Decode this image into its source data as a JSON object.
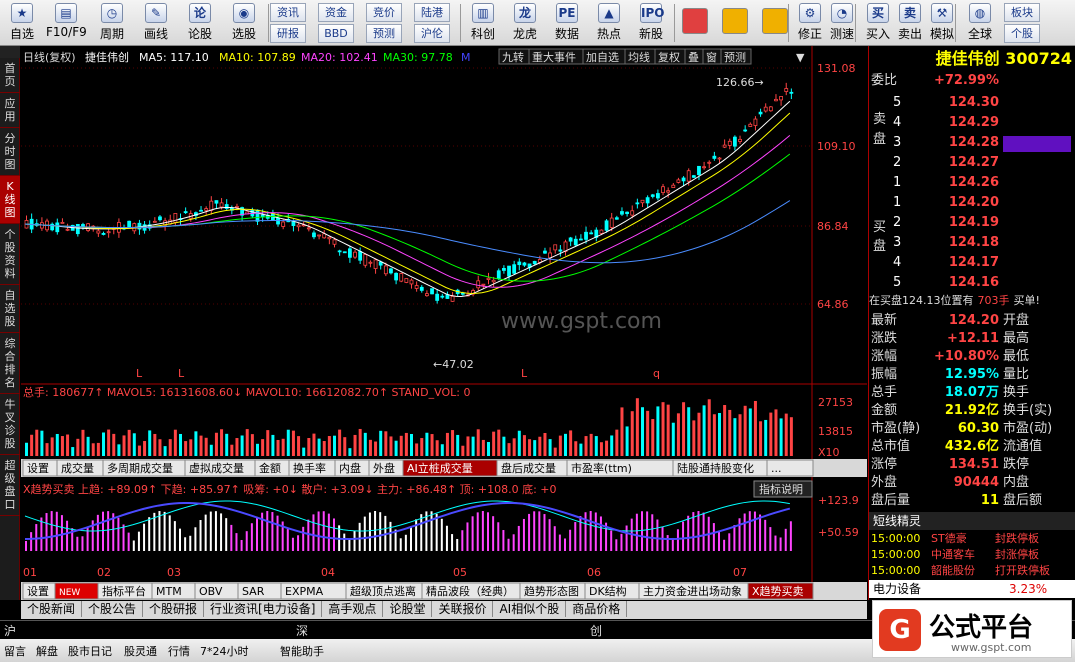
{
  "toolbar": {
    "items": [
      "自选",
      "F10/F9",
      "周期",
      "画线",
      "论股",
      "选股",
      "资讯",
      "研报",
      "资金",
      "BBD",
      "竞价",
      "预测",
      "陆港",
      "沪伦",
      "科创",
      "龙虎",
      "数据",
      "热点",
      "新股",
      "修正",
      "测速",
      "买入",
      "卖出",
      "模拟",
      "全球",
      "板块",
      "个股"
    ]
  },
  "leftnav": [
    "首页",
    "应用",
    "分时图",
    "K线图",
    "个股资料",
    "自选股",
    "综合排名",
    "牛叉诊股",
    "超级盘口"
  ],
  "chart": {
    "header": {
      "mode": "日线(复权)",
      "name": "捷佳伟创",
      "ma5": "MA5: 117.10",
      "ma10": "MA10: 107.89",
      "ma20": "MA20: 102.41",
      "ma30": "MA30: 97.78",
      "m": "M"
    },
    "toptabs": [
      "九转",
      "重大事件",
      "加自选",
      "均线",
      "复权",
      "叠",
      "窗",
      "预测"
    ],
    "yticks": [
      "131.08",
      "109.10",
      "86.84",
      "64.86"
    ],
    "high_label": "126.66",
    "low_label": "47.02",
    "vol_header": "总手: 180677↑ MAVOL5: 16131608.60↓ MAVOL10: 16612082.70↑ STAND_VOL: 0",
    "vol_ticks": [
      "27153",
      "13815",
      "X10"
    ],
    "mid_tabs": [
      "设置",
      "成交量",
      "多周期成交量",
      "虚拟成交量",
      "金额",
      "换手率",
      "内盘",
      "外盘",
      "AI立桩成交量",
      "盘后成交量",
      "市盈率(ttm)",
      "陆股通持股变化",
      "..."
    ],
    "ind_header": "X趋势买卖 上趋: +89.09↑ 下趋: +85.97↑ 吸筹: +0↓ 散户: +3.09↓ 主力: +86.48↑ 顶: +108.0 底: +0",
    "ind_btn": "指标说明",
    "ind_ticks": [
      "+123.9",
      "+50.59"
    ],
    "months": [
      "01",
      "02",
      "03",
      "04",
      "05",
      "06",
      "07"
    ],
    "ind_tabs": [
      "设置",
      "NEW",
      "指标平台",
      "MTM",
      "OBV",
      "SAR",
      "EXPMA",
      "超级顶点逃离",
      "精品波段（经典）",
      "趋势形态图",
      "DK结构",
      "主力资金进出场动象",
      "X趋势买卖"
    ],
    "info_tabs": [
      "个股新闻",
      "个股公告",
      "个股研报",
      "行业资讯[电力设备]",
      "高手观点",
      "论股堂",
      "关联报价",
      "AI相似个股",
      "商品价格"
    ],
    "watermark": "www.gspt.com"
  },
  "quote": {
    "title": "捷佳伟创 300724",
    "weibi_label": "委比",
    "weibi": "+72.99%",
    "sell_label": "卖盘",
    "buy_label": "买盘",
    "sells": [
      [
        "5",
        "124.30"
      ],
      [
        "4",
        "124.29"
      ],
      [
        "3",
        "124.28"
      ],
      [
        "2",
        "124.27"
      ],
      [
        "1",
        "124.26"
      ]
    ],
    "buys": [
      [
        "1",
        "124.20"
      ],
      [
        "2",
        "124.19"
      ],
      [
        "3",
        "124.18"
      ],
      [
        "4",
        "124.17"
      ],
      [
        "5",
        "124.16"
      ]
    ],
    "note": "在买盘124.13位置有",
    "note2": "703手",
    "note3": "买单!",
    "stats": [
      [
        "最新",
        "124.20",
        "开盘"
      ],
      [
        "涨跌",
        "+12.11",
        "最高"
      ],
      [
        "涨幅",
        "+10.80%",
        "最低"
      ],
      [
        "振幅",
        "12.95%",
        "量比"
      ],
      [
        "总手",
        "18.07万",
        "换手"
      ],
      [
        "金额",
        "21.92亿",
        "换手(实)"
      ],
      [
        "市盈(静)",
        "60.30",
        "市盈(动)"
      ],
      [
        "总市值",
        "432.6亿",
        "流通值"
      ],
      [
        "涨停",
        "134.51",
        "跌停"
      ],
      [
        "外盘",
        "90444",
        "内盘"
      ],
      [
        "盘后量",
        "11",
        "盘后额"
      ]
    ],
    "elves_title": "短线精灵",
    "elves": [
      [
        "15:00:00",
        "ST德豪",
        "封跌停板"
      ],
      [
        "15:00:00",
        "中通客车",
        "封涨停板"
      ],
      [
        "15:00:00",
        "韶能股份",
        "打开跌停板"
      ]
    ],
    "sector": "电力设备",
    "sector_val": "3.23%"
  },
  "status": {
    "items": [
      "沪",
      "深",
      "创"
    ],
    "bottom": [
      "留言",
      "解盘",
      "股市日记",
      "股灵通",
      "行情",
      "7*24小时",
      "智能助手"
    ],
    "logo": "公式平台",
    "logo_url": "www.gspt.com"
  }
}
